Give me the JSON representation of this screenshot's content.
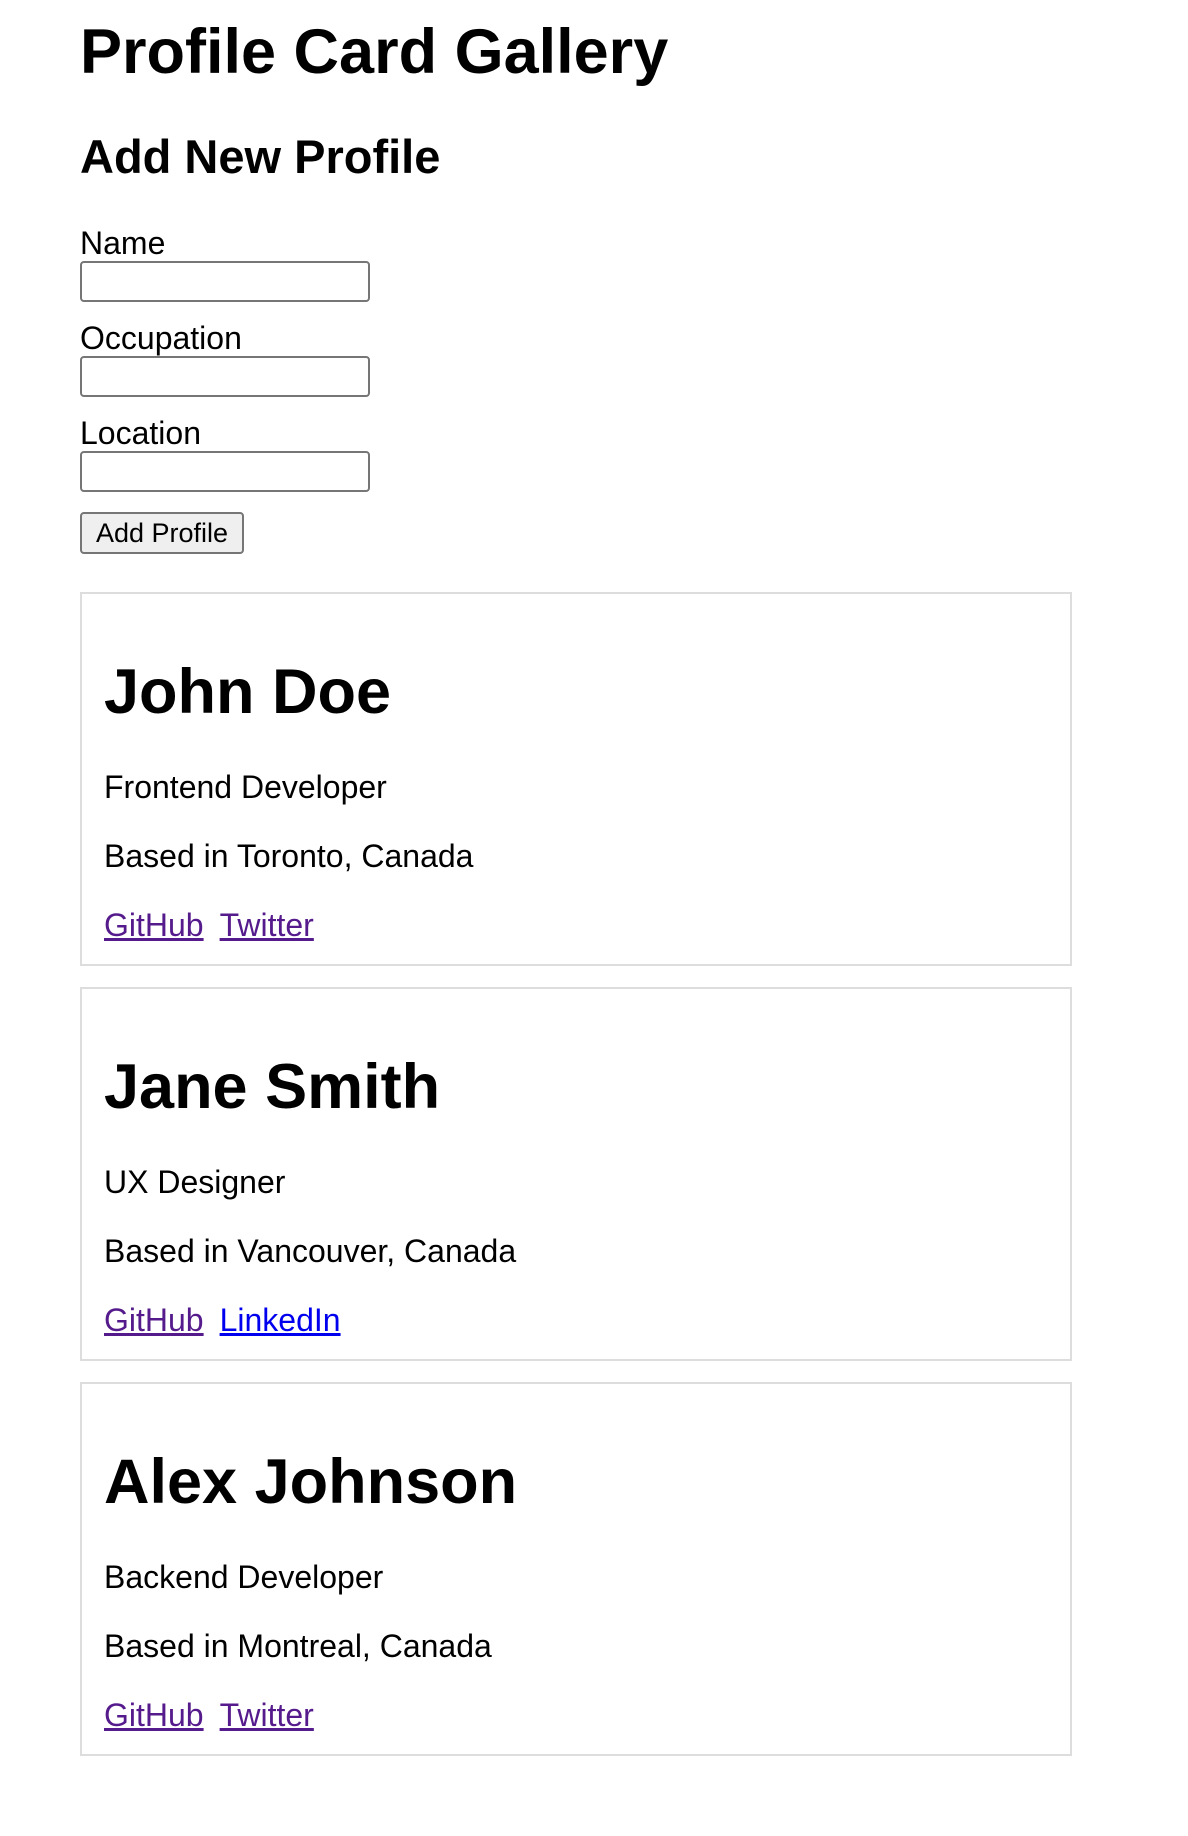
{
  "header": {
    "title": "Profile Card Gallery"
  },
  "form": {
    "title": "Add New Profile",
    "name_label": "Name",
    "name_value": "",
    "occupation_label": "Occupation",
    "occupation_value": "",
    "location_label": "Location",
    "location_value": "",
    "submit_label": "Add Profile"
  },
  "profiles": [
    {
      "name": "John Doe",
      "occupation": "Frontend Developer",
      "location": "Based in Toronto, Canada",
      "links": [
        {
          "label": "GitHub",
          "visited": true
        },
        {
          "label": "Twitter",
          "visited": true
        }
      ]
    },
    {
      "name": "Jane Smith",
      "occupation": "UX Designer",
      "location": "Based in Vancouver, Canada",
      "links": [
        {
          "label": "GitHub",
          "visited": true
        },
        {
          "label": "LinkedIn",
          "visited": false
        }
      ]
    },
    {
      "name": "Alex Johnson",
      "occupation": "Backend Developer",
      "location": "Based in Montreal, Canada",
      "links": [
        {
          "label": "GitHub",
          "visited": true
        },
        {
          "label": "Twitter",
          "visited": true
        }
      ]
    }
  ],
  "colors": {
    "link_visited": "#551a8b",
    "link_unvisited": "#0000ee",
    "card_border": "#dddddd"
  }
}
